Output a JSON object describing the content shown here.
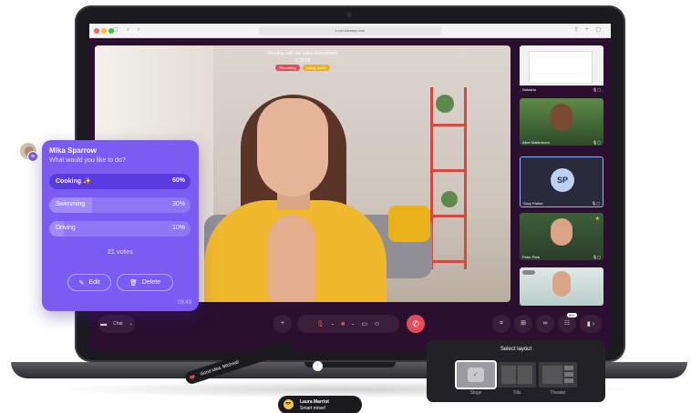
{
  "browser": {
    "url": "e-net.icewarp.com"
  },
  "meeting": {
    "logo": "IceWarp",
    "title": "Meeting with the sales department",
    "time": "1:25:08",
    "badges": [
      {
        "label": "Recording",
        "color": "#e74a57"
      },
      {
        "label": "Lobby mode",
        "color": "#e9b21a"
      }
    ]
  },
  "participants": [
    {
      "name": "Natasha"
    },
    {
      "name": "Alice Mattenhom"
    },
    {
      "name": "Suzy Parker",
      "initials": "SP"
    },
    {
      "name": "Peter Park"
    },
    {
      "name": ""
    }
  ],
  "toolbar": {
    "chat_label": "Chat",
    "participants_count": "99+"
  },
  "poll": {
    "author": "Mika Sparrow",
    "question": "What would you like to do?",
    "options": [
      {
        "label": "Cooking ✨",
        "percent_label": "60%",
        "percent": 60
      },
      {
        "label": "Swimming",
        "percent_label": "30%",
        "percent": 30
      },
      {
        "label": "Driving",
        "percent_label": "10%",
        "percent": 10
      }
    ],
    "votes": "21 votes",
    "edit_label": "Edit",
    "delete_label": "Delete",
    "time": "09:43"
  },
  "layout_panel": {
    "title": "Select layout",
    "options": [
      {
        "label": "Stage",
        "selected": true
      },
      {
        "label": "Tills",
        "selected": false
      },
      {
        "label": "Theater",
        "selected": false
      }
    ]
  },
  "reaction": {
    "text": "Good idea, Micheal!"
  },
  "chat_bubble": {
    "name": "Laura Marriot",
    "message": "Smart move!"
  },
  "colors": {
    "poll_bg": "#7a5cf2",
    "poll_selected": "#5a3be0",
    "end_call": "#e74a57",
    "screen_bg": "#2a0f2f"
  }
}
